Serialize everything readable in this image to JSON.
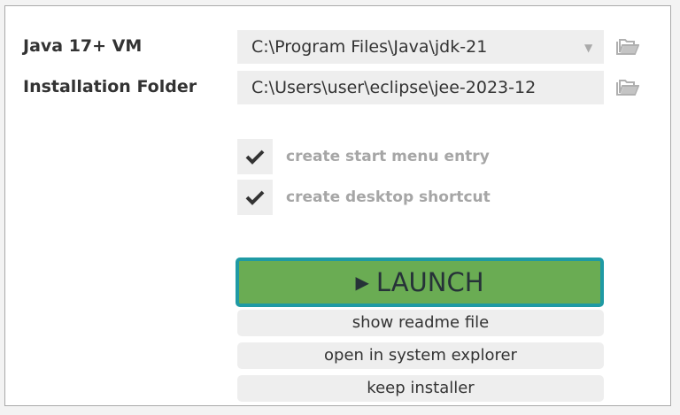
{
  "form": {
    "java_vm_label": "Java 17+ VM",
    "java_vm_value": "C:\\Program Files\\Java\\jdk-21",
    "install_folder_label": "Installation Folder",
    "install_folder_value": "C:\\Users\\user\\eclipse\\jee-2023-12"
  },
  "options": {
    "start_menu_label": "create start menu entry",
    "start_menu_checked": true,
    "desktop_shortcut_label": "create desktop shortcut",
    "desktop_shortcut_checked": true
  },
  "actions": {
    "launch_label": "LAUNCH",
    "readme_label": "show readme file",
    "explorer_label": "open in system explorer",
    "keep_installer_label": "keep installer"
  },
  "colors": {
    "launch_bg": "#6aac53",
    "launch_border": "#1f9aa4",
    "field_bg": "#eeeeee",
    "checkbox_label": "#a6a6a6"
  }
}
